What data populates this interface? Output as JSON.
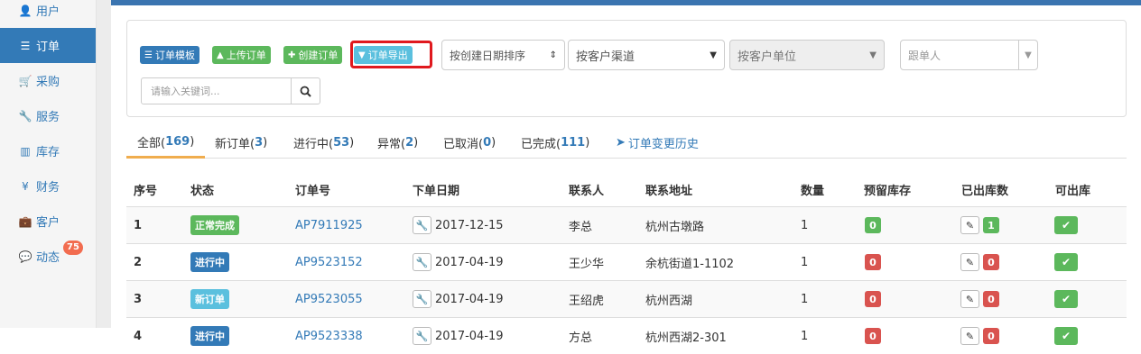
{
  "sidebar": {
    "items": [
      {
        "label": "用户",
        "icon": "user-icon",
        "glyph": "👤"
      },
      {
        "label": "订单",
        "icon": "list-icon",
        "glyph": "☰"
      },
      {
        "label": "采购",
        "icon": "cart-icon",
        "glyph": "🛒"
      },
      {
        "label": "服务",
        "icon": "wrench-icon",
        "glyph": "🔧"
      },
      {
        "label": "库存",
        "icon": "barcode-icon",
        "glyph": "▥"
      },
      {
        "label": "财务",
        "icon": "yen-icon",
        "glyph": "¥"
      },
      {
        "label": "客户",
        "icon": "briefcase-icon",
        "glyph": "💼"
      },
      {
        "label": "动态",
        "icon": "comment-icon",
        "glyph": "💬",
        "badge": "75"
      }
    ],
    "active_index": 1
  },
  "toolbar": {
    "template_label": "订单模板",
    "upload_label": "上传订单",
    "create_label": "创建订单",
    "export_label": "订单导出",
    "sort_select": "按创建日期排序",
    "channel_select": "按客户渠道",
    "unit_select": "按客户单位",
    "follower_placeholder": "跟单人",
    "search_placeholder": "请输入关键词..."
  },
  "tabs": [
    {
      "label": "全部(",
      "count": "169",
      "close": ")"
    },
    {
      "label": "新订单(",
      "count": "3",
      "close": ")"
    },
    {
      "label": "进行中(",
      "count": "53",
      "close": ")"
    },
    {
      "label": "异常(",
      "count": "2",
      "close": ")"
    },
    {
      "label": "已取消(",
      "count": "0",
      "close": ")"
    },
    {
      "label": "已完成(",
      "count": "111",
      "close": ")"
    }
  ],
  "history_link": "订单变更历史",
  "table": {
    "headers": [
      "序号",
      "状态",
      "订单号",
      "下单日期",
      "联系人",
      "联系地址",
      "数量",
      "预留库存",
      "已出库数",
      "可出库"
    ],
    "rows": [
      {
        "index": "1",
        "status": "正常完成",
        "status_color": "#5cb85c",
        "order_no": "AP7911925",
        "date": "2017-12-15",
        "contact": "李总",
        "address": "杭州古墩路",
        "qty": "1",
        "reserved": "0",
        "reserved_color": "#5cb85c",
        "shipped": "1",
        "shipped_color": "#5cb85c"
      },
      {
        "index": "2",
        "status": "进行中",
        "status_color": "#337ab7",
        "order_no": "AP9523152",
        "date": "2017-04-19",
        "contact": "王少华",
        "address": "余杭街道1-1102",
        "qty": "1",
        "reserved": "0",
        "reserved_color": "#d9534f",
        "shipped": "0",
        "shipped_color": "#d9534f"
      },
      {
        "index": "3",
        "status": "新订单",
        "status_color": "#5bc0de",
        "order_no": "AP9523055",
        "date": "2017-04-19",
        "contact": "王绍虎",
        "address": "杭州西湖",
        "qty": "1",
        "reserved": "0",
        "reserved_color": "#d9534f",
        "shipped": "0",
        "shipped_color": "#d9534f"
      },
      {
        "index": "4",
        "status": "进行中",
        "status_color": "#337ab7",
        "order_no": "AP9523338",
        "date": "2017-04-19",
        "contact": "方总",
        "address": "杭州西湖2-301",
        "qty": "1",
        "reserved": "0",
        "reserved_color": "#d9534f",
        "shipped": "0",
        "shipped_color": "#d9534f"
      }
    ]
  },
  "colors": {
    "primary": "#337ab7",
    "success": "#5cb85c",
    "info": "#5bc0de",
    "danger": "#d9534f",
    "highlight_border": "#e0191e",
    "active_tab_underline": "#f0ad4e"
  }
}
